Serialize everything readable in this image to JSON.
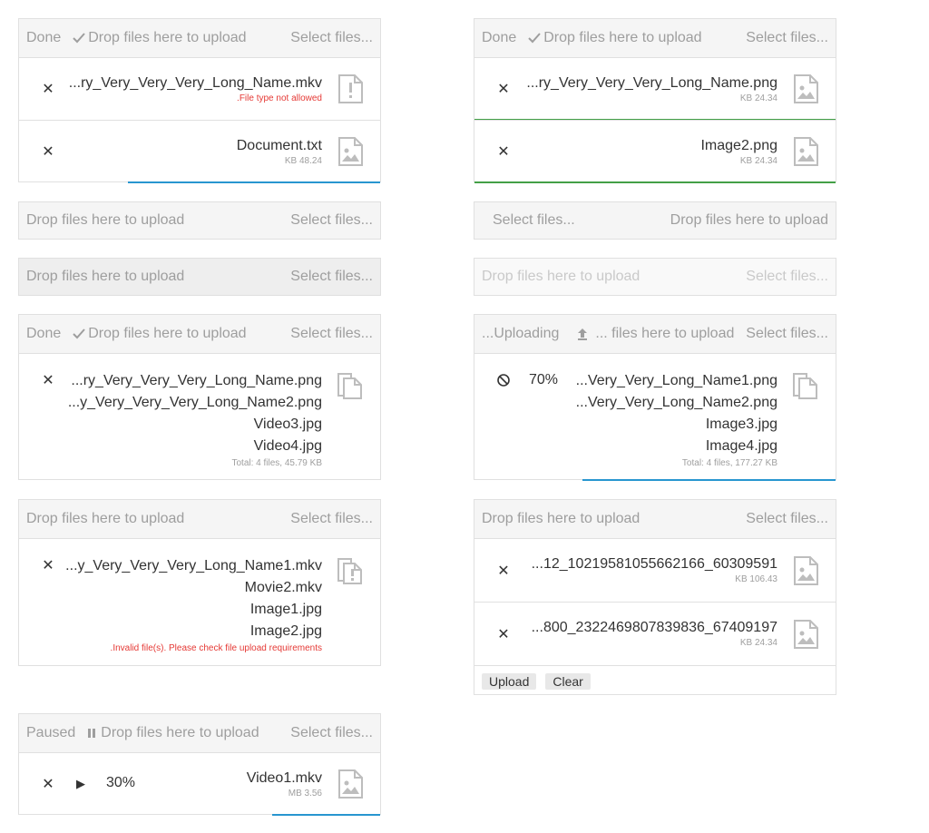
{
  "common": {
    "drop_hint": "Drop files here to upload",
    "select_files": "Select files...",
    "done": "Done",
    "uploading": "...Uploading",
    "paused": "Paused",
    "drop_hint_truncated": "... files here to upload"
  },
  "colors": {
    "progress": "#2896d0",
    "success": "#43a047",
    "error": "#e53935"
  },
  "u1": {
    "files": [
      {
        "name": "...ry_Very_Very_Very_Long_Name.mkv",
        "error": ".File type not allowed",
        "icon": "warning-file-icon"
      },
      {
        "name": "Document.txt",
        "size": "KB 48.24",
        "progress": 0.7,
        "icon": "image-file-icon"
      }
    ]
  },
  "u2": {
    "files": [
      {
        "name": "...ry_Very_Very_Very_Long_Name.png",
        "size": "KB 24.34",
        "icon": "image-file-icon"
      },
      {
        "name": "Image2.png",
        "size": "KB 24.34",
        "icon": "image-file-icon"
      }
    ]
  },
  "u5": {
    "files": [
      "...ry_Very_Very_Very_Long_Name.png",
      "...y_Very_Very_Very_Long_Name2.png",
      "Video3.jpg",
      "Video4.jpg"
    ],
    "total": "Total: 4 files, 45.79 KB"
  },
  "u6": {
    "files": [
      "...Very_Very_Long_Name1.png",
      "...Very_Very_Long_Name2.png",
      "Image3.jpg",
      "Image4.jpg"
    ],
    "total": "Total: 4 files, 177.27 KB",
    "percent": "70%",
    "progress": 0.7
  },
  "u7": {
    "files": [
      "...y_Very_Very_Very_Long_Name1.mkv",
      "Movie2.mkv",
      "Image1.jpg",
      "Image2.jpg"
    ],
    "error": ".Invalid file(s). Please check file upload requirements"
  },
  "u8": {
    "files": [
      {
        "name": "...12_10219581055662166_60309591",
        "size": "KB 106.43"
      },
      {
        "name": "...800_2322469807839836_67409197",
        "size": "KB 24.34"
      }
    ],
    "upload_label": "Upload",
    "clear_label": "Clear"
  },
  "u9": {
    "file": {
      "name": "Video1.mkv",
      "size": "MB 3.56"
    },
    "percent": "30%",
    "progress": 0.3
  }
}
